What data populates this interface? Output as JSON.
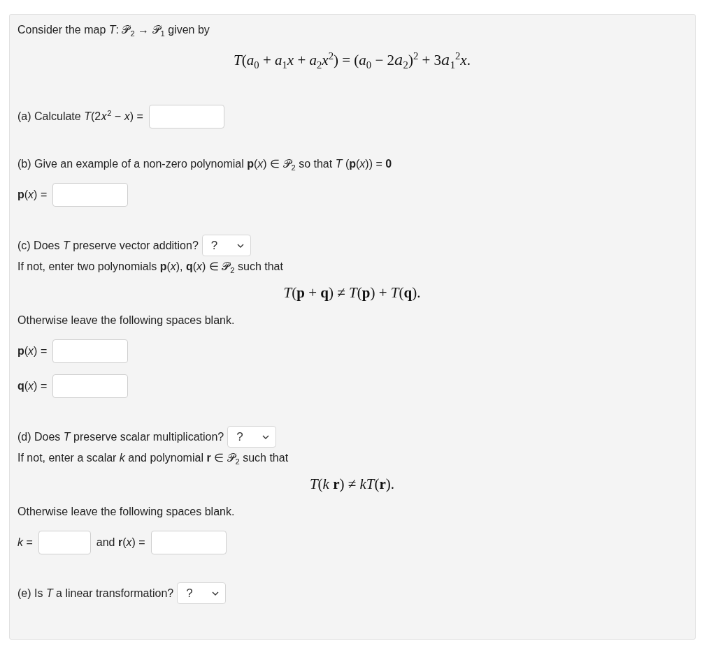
{
  "intro": {
    "text": "Consider the map *T*: 𝒫$_{2}$ → 𝒫$_{1}$ given by",
    "formula": "*T*(*a*$_{0}$ + *a*$_{1}$*x* + *a*$_{2}$*x*$^{2}$) = (*a*$_{0}$ − 2𝑎$_{2}$)$^{2}$ + 3𝑎$_{1}$$^{2}$*x*."
  },
  "parts": [
    {
      "blocks": [
        {
          "kind": "field-row",
          "fields": [
            {
              "kind": "polynomial",
              "label": "(a) Calculate *T*(2𝑥$^{2}$ − *x*) ="
            }
          ]
        }
      ]
    },
    {
      "blocks": [
        {
          "kind": "text",
          "text": "(b) Give an example of a non-zero polynomial **p**(*x*) ∈ 𝒫$_{2}$ so that *T* (**p**(*x*)) = **0**"
        },
        {
          "kind": "field-row",
          "fields": [
            {
              "kind": "polynomial",
              "label": "**p**(*x*) ="
            }
          ]
        }
      ]
    },
    {
      "blocks": [
        {
          "kind": "question",
          "text": "(c) Does *T* preserve vector addition?",
          "choice": "?"
        },
        {
          "kind": "text",
          "text": "If not, enter two polynomials **p**(*x*), **q**(*x*) ∈ 𝒫$_{2}$ such that"
        },
        {
          "kind": "formula",
          "text": "*T*(**p** + **q**) ≠ *T*(**p**) + *T*(**q**)."
        },
        {
          "kind": "text",
          "text": "Otherwise leave the following spaces blank."
        },
        {
          "kind": "field-row",
          "fields": [
            {
              "kind": "polynomial",
              "label": "**p**(*x*) ="
            }
          ]
        },
        {
          "kind": "field-row",
          "fields": [
            {
              "kind": "polynomial",
              "label": "**q**(*x*) ="
            }
          ]
        }
      ]
    },
    {
      "blocks": [
        {
          "kind": "question",
          "text": "(d) Does *T* preserve scalar multiplication?",
          "choice": "?"
        },
        {
          "kind": "text",
          "text": "If not, enter a scalar *k* and polynomial **r** ∈ 𝒫$_{2}$ such that"
        },
        {
          "kind": "formula",
          "text": "*T*(*k* **r**) ≠ *kT*(**r**)."
        },
        {
          "kind": "text",
          "text": "Otherwise leave the following spaces blank."
        },
        {
          "kind": "field-row",
          "fields": [
            {
              "kind": "scalar",
              "label": "*k* ="
            },
            {
              "kind": "polynomial",
              "label": "and **r**(*x*) ="
            }
          ]
        }
      ]
    },
    {
      "blocks": [
        {
          "kind": "question",
          "text": "(e) Is *T* a linear transformation?",
          "choice": "?"
        }
      ]
    }
  ]
}
